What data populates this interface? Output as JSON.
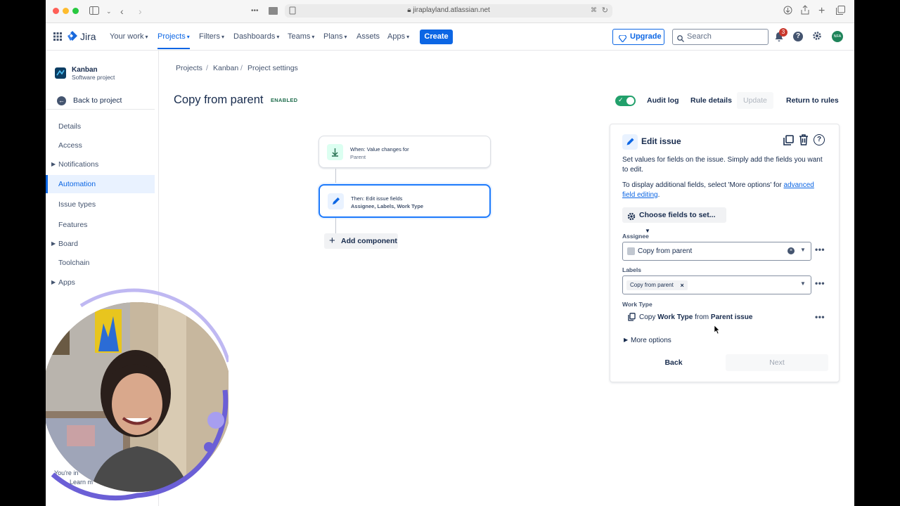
{
  "browser": {
    "url": "jiraplayland.atlassian.net"
  },
  "nav": {
    "brand": "Jira",
    "items": [
      {
        "label": "Your work",
        "chevron": true
      },
      {
        "label": "Projects",
        "chevron": true,
        "active": true
      },
      {
        "label": "Filters",
        "chevron": true
      },
      {
        "label": "Dashboards",
        "chevron": true
      },
      {
        "label": "Teams",
        "chevron": true
      },
      {
        "label": "Plans",
        "chevron": true
      },
      {
        "label": "Assets",
        "chevron": false
      },
      {
        "label": "Apps",
        "chevron": true
      }
    ],
    "create_label": "Create",
    "upgrade_label": "Upgrade",
    "search_placeholder": "Search",
    "notification_count": "3",
    "avatar_initials": "NFA"
  },
  "sidebar": {
    "project_name": "Kanban",
    "project_type": "Software project",
    "back_label": "Back to project",
    "items": [
      {
        "label": "Details",
        "expandable": false
      },
      {
        "label": "Access",
        "expandable": false
      },
      {
        "label": "Notifications",
        "expandable": true
      },
      {
        "label": "Automation",
        "expandable": false,
        "active": true
      },
      {
        "label": "Issue types",
        "expandable": false
      },
      {
        "label": "Features",
        "expandable": false
      },
      {
        "label": "Board",
        "expandable": true
      },
      {
        "label": "Toolchain",
        "expandable": false
      },
      {
        "label": "Apps",
        "expandable": true
      }
    ],
    "footer_line1": "You're in",
    "footer_line2": "Learn m"
  },
  "breadcrumbs": [
    "Projects",
    "Kanban",
    "Project settings"
  ],
  "rule": {
    "title": "Copy from parent",
    "status": "ENABLED",
    "enabled": true
  },
  "header_actions": {
    "audit_log": "Audit log",
    "rule_details": "Rule details",
    "update": "Update",
    "return": "Return to rules"
  },
  "flow": {
    "trigger": {
      "title": "When: Value changes for",
      "subtitle": "Parent"
    },
    "action": {
      "title": "Then: Edit issue fields",
      "subtitle": "Assignee, Labels, Work Type"
    },
    "add_label": "Add component"
  },
  "panel": {
    "title": "Edit issue",
    "description": "Set values for fields on the issue. Simply add the fields you want to edit.",
    "more_info_prefix": "To display additional fields, select 'More options' for ",
    "more_info_link": "advanced field editing",
    "more_info_suffix": ".",
    "choose_fields": "Choose fields to set...",
    "assignee_label": "Assignee",
    "assignee_value": "Copy from parent",
    "labels_label": "Labels",
    "labels_chip": "Copy from parent",
    "worktype_label": "Work Type",
    "worktype_copy": "Copy",
    "worktype_field": "Work Type",
    "worktype_from": "from",
    "worktype_source": "Parent issue",
    "more_options": "More options",
    "back": "Back",
    "next": "Next"
  },
  "colors": {
    "primary": "#0c66e4",
    "enabled_green": "#22a06b",
    "webcam_ring": "#6b5fd6"
  }
}
